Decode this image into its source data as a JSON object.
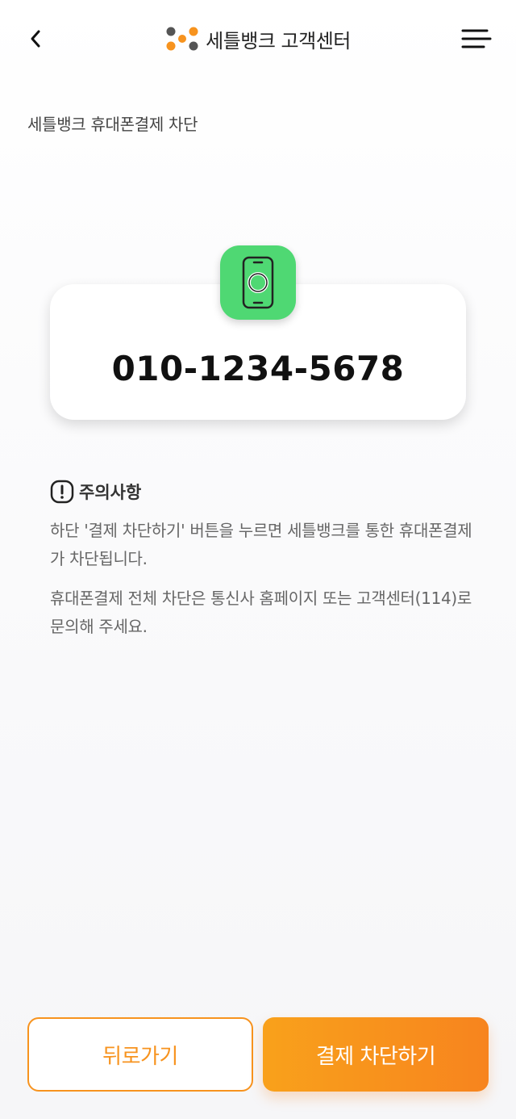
{
  "header": {
    "title": "세틀뱅크 고객센터",
    "logo_colors": [
      "#f7931e",
      "#555555"
    ]
  },
  "breadcrumb": "세틀뱅크 휴대폰결제 차단",
  "phone": {
    "number": "010-1234-5678",
    "icon": "smartphone-icon",
    "icon_bg": "#4fd873"
  },
  "notice": {
    "title": "주의사항",
    "icon": "exclamation-circle-icon",
    "paragraphs": [
      "하단 '결제 차단하기' 버튼을 누르면 세틀뱅크를 통한 휴대폰결제가 차단됩니다.",
      "휴대폰결제 전체 차단은 통신사 홈페이지 또는 고객센터(114)로 문의해 주세요."
    ]
  },
  "buttons": {
    "back_label": "뒤로가기",
    "block_label": "결제 차단하기",
    "accent": "#f7931e"
  }
}
